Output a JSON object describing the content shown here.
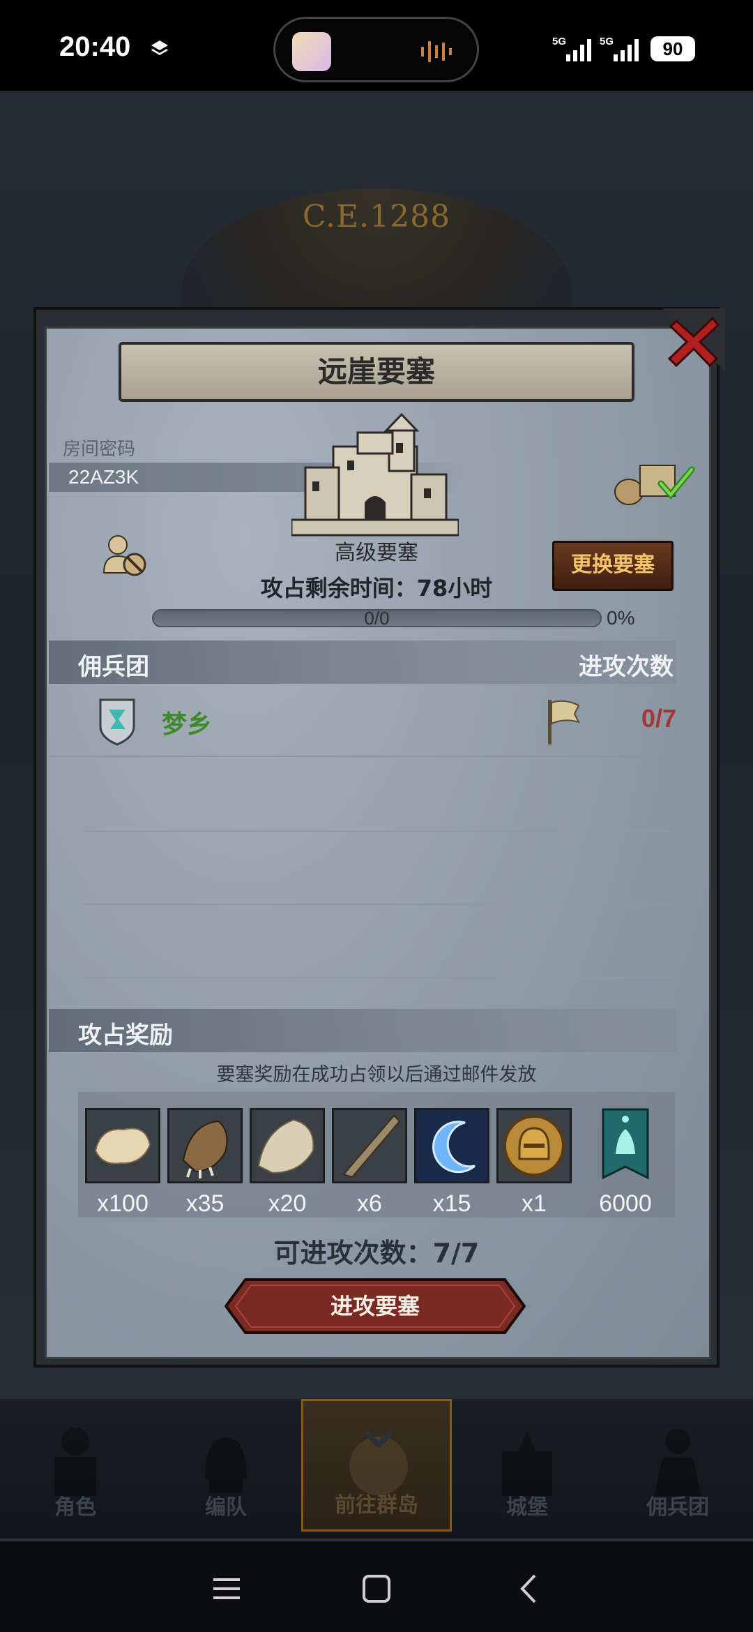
{
  "status_bar": {
    "time": "20:40",
    "battery": "90",
    "icons": [
      "layers-icon",
      "signal-5g-icon",
      "signal-5g-icon"
    ]
  },
  "background": {
    "year": "C.E.1288"
  },
  "dialog": {
    "title": "远崖要塞",
    "room_label": "房间密码",
    "room_code": "22AZ3K",
    "fort_type": "高级要塞",
    "time_left": "攻占剩余时间：78小时",
    "change_button": "更换要塞",
    "progress_text": "0/0",
    "progress_pct": "0%",
    "progress_value": 0,
    "mercenary_header": "佣兵团",
    "attack_count_header": "进攻次数",
    "mercenaries": [
      {
        "name": "梦乡",
        "attacks": "0/7"
      }
    ],
    "rewards_header": "攻占奖励",
    "rewards_note": "要塞奖励在成功占领以后通过邮件发放",
    "rewards": [
      {
        "item": "fur-icon",
        "qty": "x100"
      },
      {
        "item": "claw-icon",
        "qty": "x35"
      },
      {
        "item": "hide-icon",
        "qty": "x20"
      },
      {
        "item": "horn-icon",
        "qty": "x6"
      },
      {
        "item": "crescent-orb-icon",
        "qty": "x15"
      },
      {
        "item": "helmet-coin-icon",
        "qty": "x1"
      },
      {
        "item": "banner-icon",
        "qty": "6000"
      }
    ],
    "attacks_available": "可进攻次数：7/7",
    "attack_button": "进攻要塞"
  },
  "bottom_nav": [
    {
      "label": "角色",
      "icon": "knight-icon"
    },
    {
      "label": "编队",
      "icon": "helmet-icon"
    },
    {
      "label": "前往群岛",
      "icon": "compass-globe-icon",
      "active": true
    },
    {
      "label": "城堡",
      "icon": "castle-icon"
    },
    {
      "label": "佣兵团",
      "icon": "mercenary-icon"
    }
  ],
  "colors": {
    "panel": "#95a0ac",
    "mercenary_name": "#3f8a2a",
    "attack_count": "#a33636",
    "change_button_text": "#f3c46a",
    "attack_button": "#7a2a22"
  }
}
